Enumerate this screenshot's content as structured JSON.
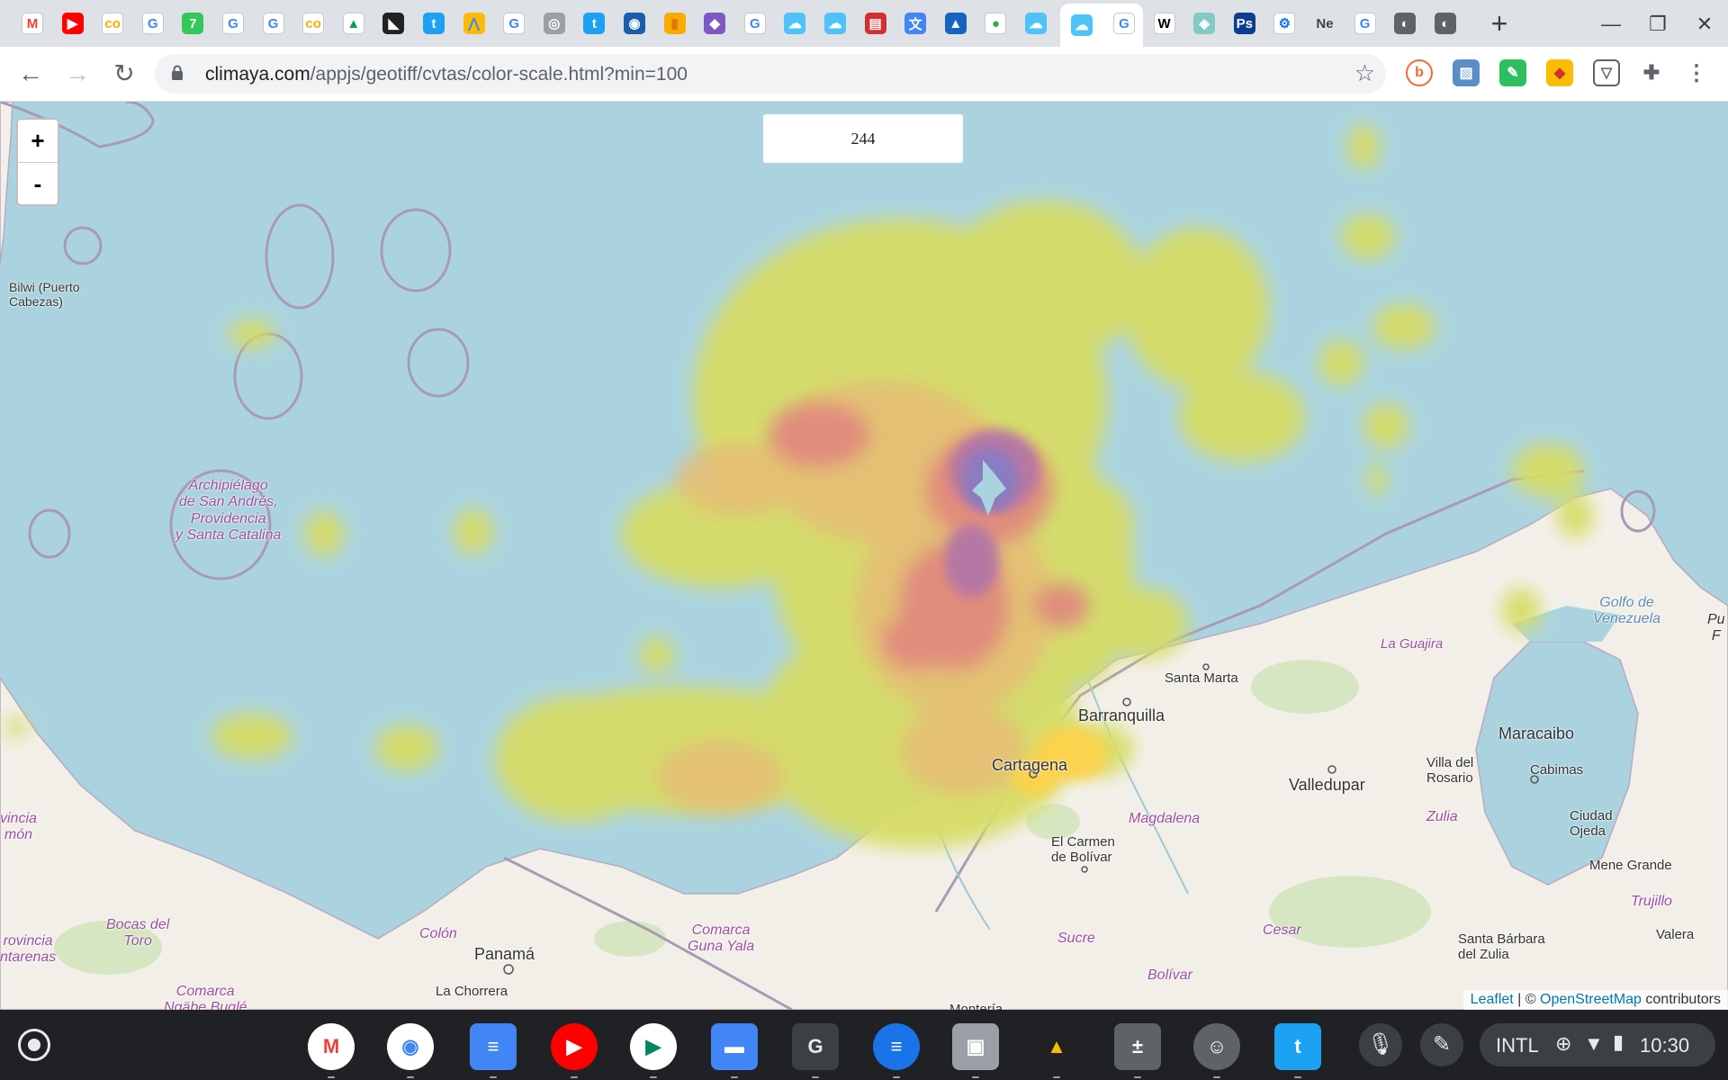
{
  "browser": {
    "tabs": [
      {
        "icon": "gmail-icon",
        "glyph": "M",
        "bg": "#ffffff",
        "fg": "#ea4335"
      },
      {
        "icon": "youtube-icon",
        "glyph": "▶",
        "bg": "#ff0000",
        "fg": "#ffffff"
      },
      {
        "icon": "colab-icon",
        "glyph": "co",
        "bg": "#ffffff",
        "fg": "#f9ab00"
      },
      {
        "icon": "google-icon",
        "glyph": "G",
        "bg": "#ffffff",
        "fg": "#4285f4"
      },
      {
        "icon": "seven-icon",
        "glyph": "7",
        "bg": "#34c759",
        "fg": "#ffffff"
      },
      {
        "icon": "google-icon",
        "glyph": "G",
        "bg": "#ffffff",
        "fg": "#4285f4"
      },
      {
        "icon": "google-icon",
        "glyph": "G",
        "bg": "#ffffff",
        "fg": "#4285f4"
      },
      {
        "icon": "colab-icon",
        "glyph": "co",
        "bg": "#ffffff",
        "fg": "#f9ab00"
      },
      {
        "icon": "drive-icon",
        "glyph": "▲",
        "bg": "#ffffff",
        "fg": "#0f9d58"
      },
      {
        "icon": "owl-icon",
        "glyph": "◣",
        "bg": "#222222",
        "fg": "#ffffff"
      },
      {
        "icon": "twitter-icon",
        "glyph": "t",
        "bg": "#1da1f2",
        "fg": "#ffffff"
      },
      {
        "icon": "ads-icon",
        "glyph": "⋀",
        "bg": "#fbbc04",
        "fg": "#4285f4"
      },
      {
        "icon": "google-icon",
        "glyph": "G",
        "bg": "#ffffff",
        "fg": "#4285f4"
      },
      {
        "icon": "satellite-icon",
        "glyph": "◎",
        "bg": "#9aa0a6",
        "fg": "#ffffff"
      },
      {
        "icon": "twitter-icon",
        "glyph": "t",
        "bg": "#1da1f2",
        "fg": "#ffffff"
      },
      {
        "icon": "noaa-icon",
        "glyph": "◉",
        "bg": "#1a5dab",
        "fg": "#ffffff"
      },
      {
        "icon": "analytics-icon",
        "glyph": "▮",
        "bg": "#f9ab00",
        "fg": "#e37400"
      },
      {
        "icon": "cube-icon",
        "glyph": "◆",
        "bg": "#7e57c2",
        "fg": "#ffffff"
      },
      {
        "icon": "google-icon",
        "glyph": "G",
        "bg": "#ffffff",
        "fg": "#4285f4"
      },
      {
        "icon": "weather-icon",
        "glyph": "☁",
        "bg": "#4fc3f7",
        "fg": "#ffffff"
      },
      {
        "icon": "weather-icon",
        "glyph": "☁",
        "bg": "#4fc3f7",
        "fg": "#ffffff"
      },
      {
        "icon": "red-box-icon",
        "glyph": "▤",
        "bg": "#d32f2f",
        "fg": "#ffffff"
      },
      {
        "icon": "translate-icon",
        "glyph": "文",
        "bg": "#4285f4",
        "fg": "#ffffff"
      },
      {
        "icon": "mountain-icon",
        "glyph": "▲",
        "bg": "#1565c0",
        "fg": "#ffffff"
      },
      {
        "icon": "maps-icon",
        "glyph": "●",
        "bg": "#ffffff",
        "fg": "#34a853"
      },
      {
        "icon": "weather-icon",
        "glyph": "☁",
        "bg": "#4fc3f7",
        "fg": "#ffffff"
      }
    ],
    "tabs_after": [
      {
        "icon": "google-icon",
        "glyph": "G",
        "bg": "#ffffff",
        "fg": "#4285f4"
      },
      {
        "icon": "wikipedia-icon",
        "glyph": "W",
        "bg": "#ffffff",
        "fg": "#000000"
      },
      {
        "icon": "map-app-icon",
        "glyph": "◈",
        "bg": "#80cbc4",
        "fg": "#ffffff"
      },
      {
        "icon": "photoshop-icon",
        "glyph": "Ps",
        "bg": "#0b3d91",
        "fg": "#ffffff"
      },
      {
        "icon": "settings-icon",
        "glyph": "⚙",
        "bg": "#ffffff",
        "fg": "#1a73e8"
      },
      {
        "icon": "ne-text-icon",
        "glyph": "Ne",
        "bg": "#dee1e6",
        "fg": "#444444"
      },
      {
        "icon": "google-icon",
        "glyph": "G",
        "bg": "#ffffff",
        "fg": "#4285f4"
      },
      {
        "icon": "globe-icon",
        "glyph": "◐",
        "bg": "#5f6368",
        "fg": "#ffffff"
      },
      {
        "icon": "globe-icon",
        "glyph": "◐",
        "bg": "#5f6368",
        "fg": "#ffffff"
      }
    ],
    "url_domain": "climaya.com",
    "url_path": "/appjs/geotiff/cvtas/color-scale.html?min=100"
  },
  "map": {
    "value": "244",
    "zoom_in": "+",
    "zoom_out": "-",
    "attribution": {
      "leaflet": "Leaflet",
      "sep": " | © ",
      "osm": "OpenStreetMap",
      "suffix": " contributors"
    },
    "places": [
      {
        "name": "Bilwi (Puerto\nCabezas)",
        "kind": "small"
      },
      {
        "name": "Archipiélago\nde San Andrés,\nProvidencia\ny Santa Catalina",
        "kind": "region"
      },
      {
        "name": "Santa Marta",
        "kind": "city"
      },
      {
        "name": "Barranquilla",
        "kind": "bigcity"
      },
      {
        "name": "Cartagena",
        "kind": "bigcity"
      },
      {
        "name": "La Guajira",
        "kind": "region"
      },
      {
        "name": "Golfo de\nVenezuela",
        "kind": "water"
      },
      {
        "name": "Maracaibo",
        "kind": "bigcity"
      },
      {
        "name": "Villa del\nRosario",
        "kind": "small"
      },
      {
        "name": "Cabimas",
        "kind": "small"
      },
      {
        "name": "Valledupar",
        "kind": "bigcity"
      },
      {
        "name": "Zulia",
        "kind": "region"
      },
      {
        "name": "Ciudad\nOjeda",
        "kind": "small"
      },
      {
        "name": "Magdalena",
        "kind": "region"
      },
      {
        "name": "El Carmen\nde Bolívar",
        "kind": "small"
      },
      {
        "name": "Mene Grande",
        "kind": "small"
      },
      {
        "name": "Trujillo",
        "kind": "region"
      },
      {
        "name": "Valera",
        "kind": "small"
      },
      {
        "name": "Sucre",
        "kind": "region"
      },
      {
        "name": "Cesar",
        "kind": "region"
      },
      {
        "name": "Santa Bárbara\ndel Zulia",
        "kind": "small"
      },
      {
        "name": "Bolívar",
        "kind": "region"
      },
      {
        "name": "Colón",
        "kind": "region"
      },
      {
        "name": "Panamá",
        "kind": "bigcity"
      },
      {
        "name": "Comarca\nGuna Yala",
        "kind": "region"
      },
      {
        "name": "La Chorrera",
        "kind": "small"
      },
      {
        "name": "Bocas del\nToro",
        "kind": "region"
      },
      {
        "name": "rovincia\nntarenas",
        "kind": "region"
      },
      {
        "name": "Comarca\nNgäbe Buglé",
        "kind": "region"
      },
      {
        "name": "vincia\nmón",
        "kind": "region"
      },
      {
        "name": "Montería",
        "kind": "small"
      },
      {
        "name": "Pu\nF",
        "kind": "region"
      }
    ]
  },
  "shelf": {
    "apps": [
      {
        "icon": "gmail-app-icon",
        "glyph": "M",
        "bg": "#ffffff",
        "fg": "#ea4335"
      },
      {
        "icon": "chrome-app-icon",
        "glyph": "◉",
        "bg": "#ffffff",
        "fg": "#4285f4"
      },
      {
        "icon": "docs-app-icon",
        "glyph": "≡",
        "bg": "#4285f4",
        "fg": "#ffffff"
      },
      {
        "icon": "youtube-app-icon",
        "glyph": "▶",
        "bg": "#ff0000",
        "fg": "#ffffff"
      },
      {
        "icon": "play-store-icon",
        "glyph": "▶",
        "bg": "#ffffff",
        "fg": "#01875f"
      },
      {
        "icon": "files-app-icon",
        "glyph": "▬",
        "bg": "#4285f4",
        "fg": "#ffffff"
      },
      {
        "icon": "g-app-icon",
        "glyph": "G",
        "bg": "#3c4043",
        "fg": "#e8eaed"
      },
      {
        "icon": "messages-app-icon",
        "glyph": "≡",
        "bg": "#1a73e8",
        "fg": "#ffffff"
      },
      {
        "icon": "screenshot-app-icon",
        "glyph": "▣",
        "bg": "#9aa0a6",
        "fg": "#ffffff"
      },
      {
        "icon": "drive-app-icon",
        "glyph": "▲",
        "bg": "#202124",
        "fg": "#fbbc04"
      },
      {
        "icon": "calculator-app-icon",
        "glyph": "±",
        "bg": "#5f6368",
        "fg": "#ffffff"
      },
      {
        "icon": "cat-app-icon",
        "glyph": "☺",
        "bg": "#5f6368",
        "fg": "#ffffff"
      },
      {
        "icon": "twitter-app-icon",
        "glyph": "t",
        "bg": "#1da1f2",
        "fg": "#ffffff"
      }
    ],
    "ime": "INTL",
    "time": "10:30"
  }
}
